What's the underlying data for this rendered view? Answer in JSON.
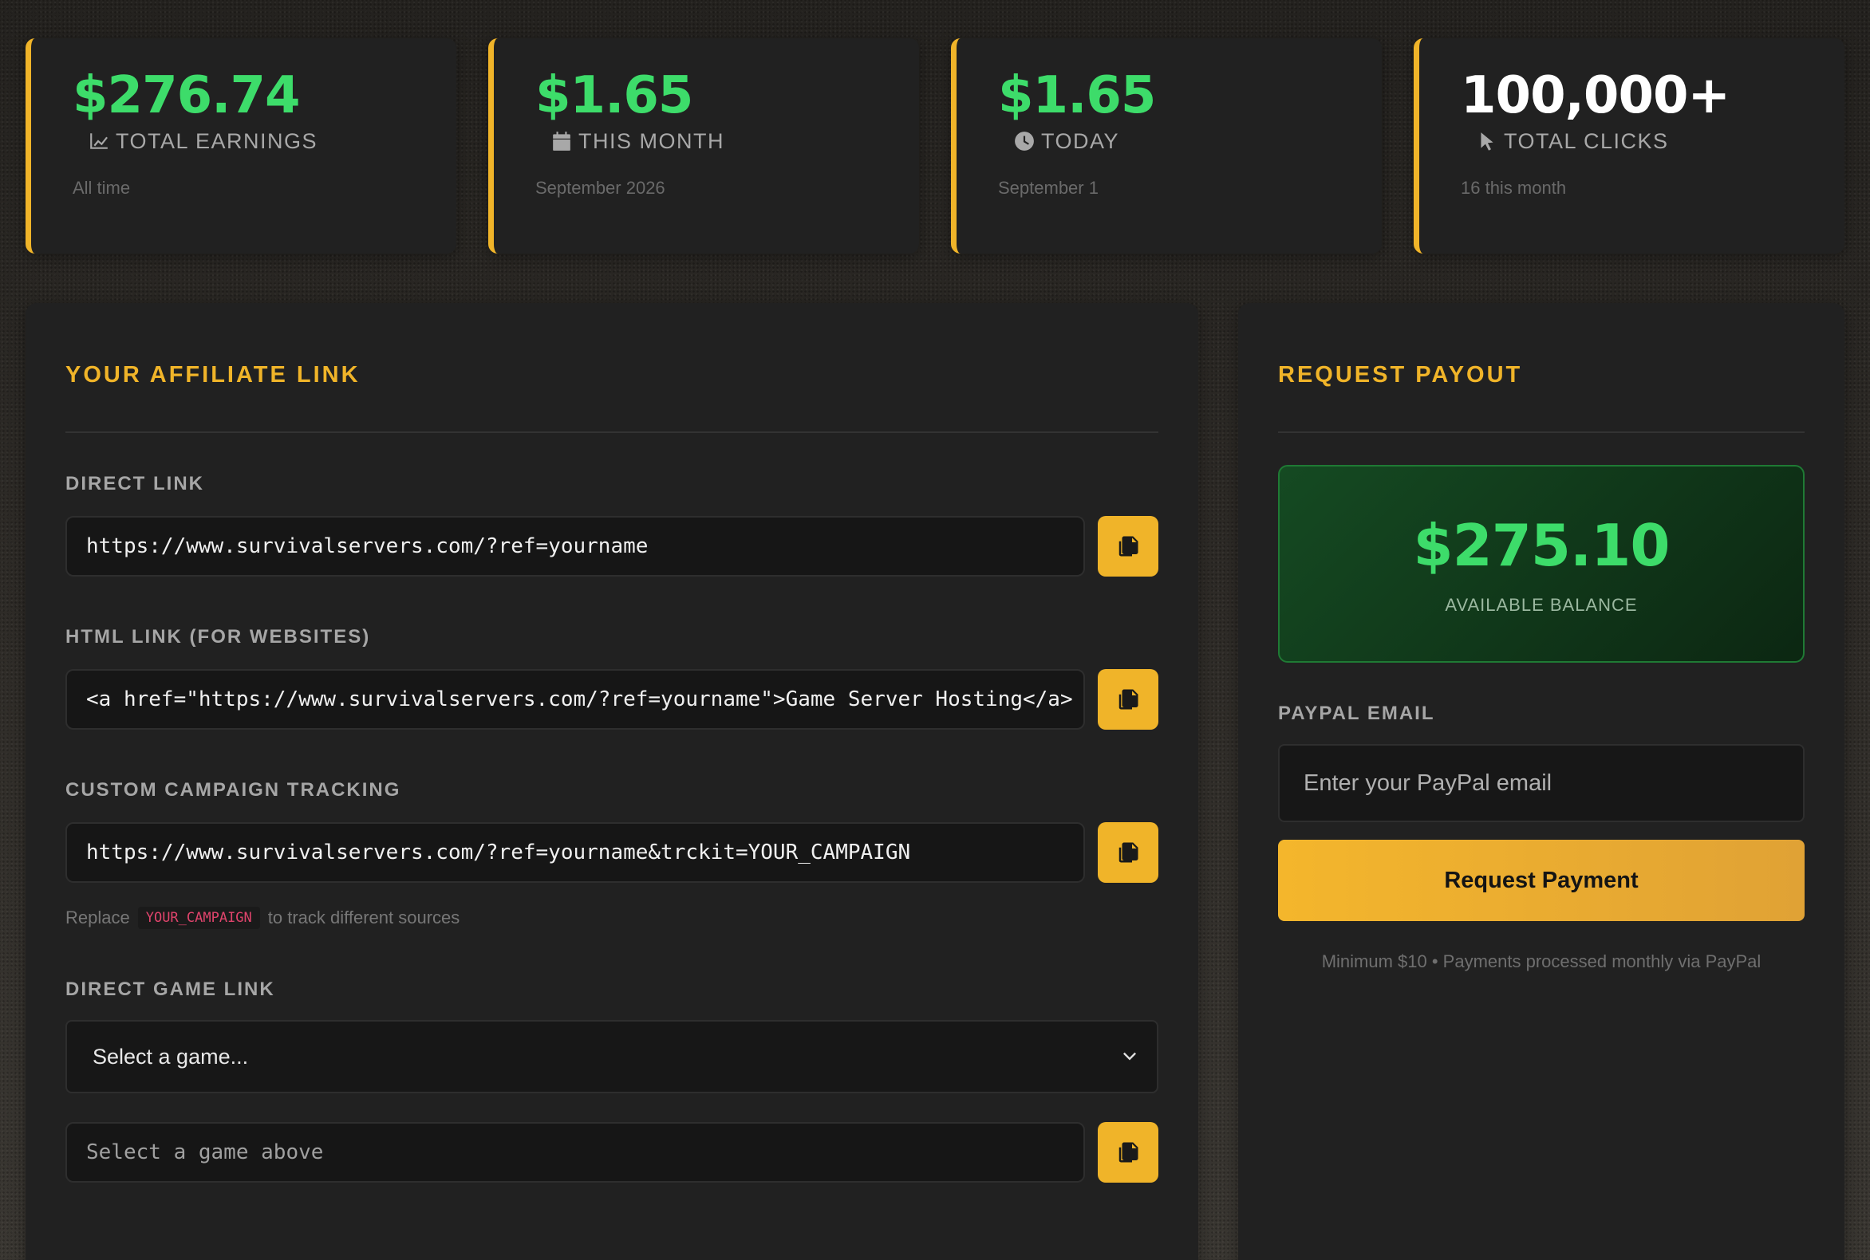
{
  "colors": {
    "accent": "#f0b429",
    "money_green": "#3ddc6a",
    "card_bg": "#212121",
    "code_highlight": "#e0446c"
  },
  "stats": [
    {
      "value": "$276.74",
      "label": "TOTAL EARNINGS",
      "sub": "All time",
      "icon": "chart-line-icon",
      "value_color": "green"
    },
    {
      "value": "$1.65",
      "label": "THIS MONTH",
      "sub": "September 2026",
      "icon": "calendar-icon",
      "value_color": "green"
    },
    {
      "value": "$1.65",
      "label": "TODAY",
      "sub": "September 1",
      "icon": "clock-icon",
      "value_color": "green"
    },
    {
      "value": "100,000+",
      "label": "TOTAL CLICKS",
      "sub": "16 this month",
      "icon": "cursor-icon",
      "value_color": "white"
    }
  ],
  "affiliate": {
    "title": "YOUR AFFILIATE LINK",
    "direct_link": {
      "label": "DIRECT LINK",
      "value": "https://www.survivalservers.com/?ref=yourname"
    },
    "html_link": {
      "label": "HTML LINK (FOR WEBSITES)",
      "value": "<a href=\"https://www.survivalservers.com/?ref=yourname\">Game Server Hosting</a>"
    },
    "campaign": {
      "label": "CUSTOM CAMPAIGN TRACKING",
      "value": "https://www.survivalservers.com/?ref=yourname&trckit=YOUR_CAMPAIGN",
      "hint_before": "Replace",
      "hint_code": "YOUR_CAMPAIGN",
      "hint_after": "to track different sources"
    },
    "game_link": {
      "label": "DIRECT GAME LINK",
      "select_value": "Select a game...",
      "output_placeholder": "Select a game above"
    },
    "copy_icon": "copy-icon"
  },
  "payout": {
    "title": "REQUEST PAYOUT",
    "balance": "$275.10",
    "balance_label": "AVAILABLE BALANCE",
    "email_label": "PAYPAL EMAIL",
    "email_placeholder": "Enter your PayPal email",
    "email_value": "",
    "button_label": "Request Payment",
    "note": "Minimum $10 • Payments processed monthly via PayPal"
  }
}
